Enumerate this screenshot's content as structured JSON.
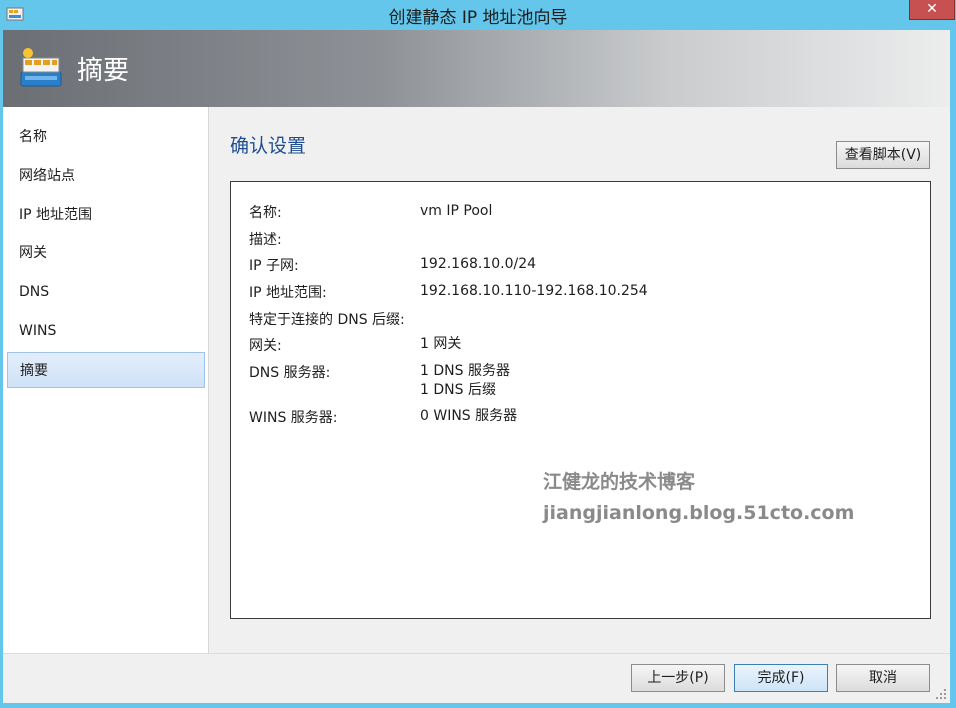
{
  "window": {
    "title": "创建静态 IP 地址池向导",
    "close_glyph": "✕"
  },
  "banner": {
    "title": "摘要",
    "icon": "ip-pool-wizard-icon"
  },
  "sidebar": {
    "items": [
      {
        "label": "名称"
      },
      {
        "label": "网络站点"
      },
      {
        "label": "IP 地址范围"
      },
      {
        "label": "网关"
      },
      {
        "label": "DNS"
      },
      {
        "label": "WINS"
      },
      {
        "label": "摘要",
        "active": true
      }
    ]
  },
  "main": {
    "section_title": "确认设置",
    "view_script_label": "查看脚本(V)",
    "summary": [
      {
        "label": "名称:",
        "value": "vm IP Pool"
      },
      {
        "label": "描述:",
        "value": ""
      },
      {
        "label": "IP 子网:",
        "value": "192.168.10.0/24"
      },
      {
        "label": "IP 地址范围:",
        "value": "192.168.10.110-192.168.10.254"
      },
      {
        "label": "特定于连接的 DNS 后缀:",
        "value": ""
      },
      {
        "label": "网关:",
        "value": "1 网关"
      },
      {
        "label": "DNS 服务器:",
        "value": "1 DNS 服务器",
        "value2": "1 DNS 后缀"
      },
      {
        "label": "WINS 服务器:",
        "value": "0 WINS 服务器"
      }
    ],
    "watermark_line1": "江健龙的技术博客",
    "watermark_line2": "jiangjianlong.blog.51cto.com"
  },
  "footer": {
    "prev_label": "上一步(P)",
    "finish_label": "完成(F)",
    "cancel_label": "取消"
  },
  "colors": {
    "titlebar": "#63c6ea",
    "section_title": "#1f4d8f",
    "active_nav": "#cfe2f8",
    "close_button": "#c75050"
  }
}
